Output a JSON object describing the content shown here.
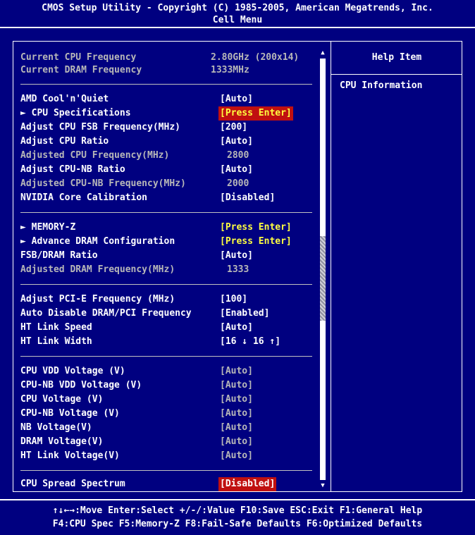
{
  "header": {
    "title": "CMOS Setup Utility - Copyright (C) 1985-2005, American Megatrends, Inc.",
    "menu": "Cell Menu"
  },
  "info": [
    {
      "label": "Current CPU Frequency",
      "value": "2.80GHz (200x14)"
    },
    {
      "label": "Current DRAM Frequency",
      "value": "1333MHz"
    }
  ],
  "group1": [
    {
      "label": "AMD Cool'n'Quiet",
      "value": "[Auto]"
    },
    {
      "label": "► CPU Specifications",
      "value": "[Press Enter]"
    },
    {
      "label": "Adjust CPU FSB Frequency(MHz)",
      "value": "[200]"
    },
    {
      "label": "Adjust CPU Ratio",
      "value": "[Auto]"
    },
    {
      "label": "Adjusted CPU Frequency(MHz)",
      "value": "2800"
    },
    {
      "label": "Adjust CPU-NB Ratio",
      "value": "[Auto]"
    },
    {
      "label": "Adjusted CPU-NB Frequency(MHz)",
      "value": "2000"
    },
    {
      "label": "NVIDIA Core Calibration",
      "value": "[Disabled]"
    }
  ],
  "group2": [
    {
      "label": "► MEMORY-Z",
      "value": "[Press Enter]"
    },
    {
      "label": "► Advance DRAM Configuration",
      "value": "[Press Enter]"
    },
    {
      "label": "FSB/DRAM Ratio",
      "value": "[Auto]"
    },
    {
      "label": "Adjusted DRAM Frequency(MHz)",
      "value": "1333"
    }
  ],
  "group3": [
    {
      "label": "Adjust PCI-E Frequency (MHz)",
      "value": "[100]"
    },
    {
      "label": "Auto Disable DRAM/PCI Frequency",
      "value": "[Enabled]"
    },
    {
      "label": "HT Link Speed",
      "value": "[Auto]"
    },
    {
      "label": "HT Link Width",
      "value": "[16 ↓ 16 ↑]"
    }
  ],
  "group4": [
    {
      "label": "CPU VDD Voltage (V)",
      "value": "[Auto]"
    },
    {
      "label": "CPU-NB VDD Voltage (V)",
      "value": "[Auto]"
    },
    {
      "label": "CPU Voltage (V)",
      "value": "[Auto]"
    },
    {
      "label": "CPU-NB Voltage (V)",
      "value": "[Auto]"
    },
    {
      "label": "NB Voltage(V)",
      "value": "[Auto]"
    },
    {
      "label": "DRAM Voltage(V)",
      "value": "[Auto]"
    },
    {
      "label": "HT Link Voltage(V)",
      "value": "[Auto]"
    }
  ],
  "group5": [
    {
      "label": "CPU Spread Spectrum",
      "value": "[Disabled]"
    }
  ],
  "help": {
    "title": "Help Item",
    "text": "CPU Information"
  },
  "footer": {
    "line1": "↑↓←→:Move  Enter:Select  +/-/:Value  F10:Save  ESC:Exit  F1:General Help",
    "line2": "F4:CPU Spec  F5:Memory-Z  F8:Fail-Safe Defaults  F6:Optimized Defaults"
  },
  "scrollbar": {
    "up_icon": "▲",
    "down_icon": "▼"
  },
  "colors": {
    "background": "#000080",
    "highlight": "#c01010",
    "submenu": "#ffff40",
    "disabled": "#b8b8b8"
  }
}
